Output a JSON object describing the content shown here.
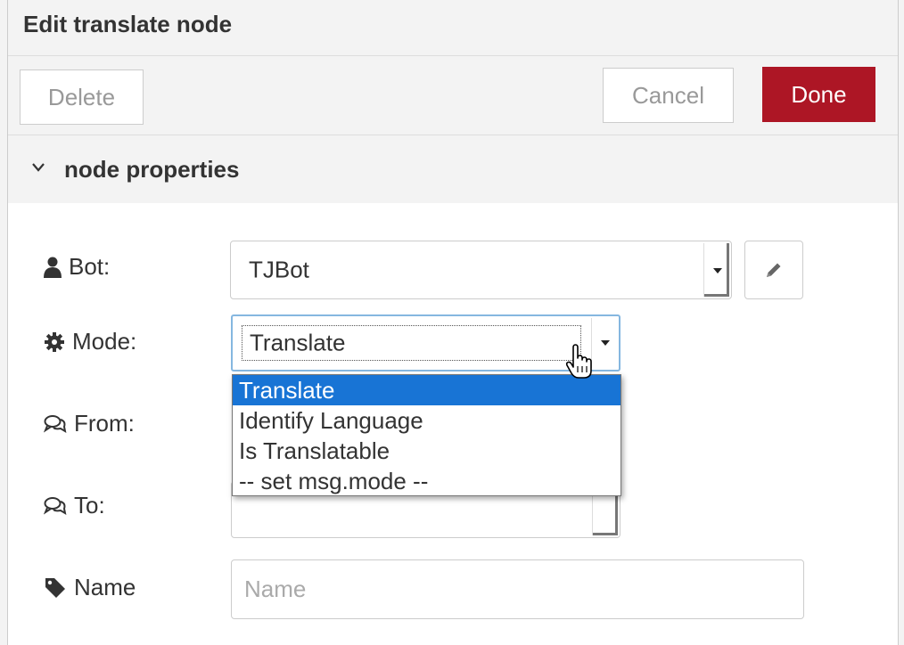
{
  "header": {
    "title": "Edit translate node"
  },
  "toolbar": {
    "delete_label": "Delete",
    "cancel_label": "Cancel",
    "done_label": "Done"
  },
  "section": {
    "title": "node properties"
  },
  "fields": {
    "bot": {
      "label": "Bot:",
      "value": "TJBot",
      "icon": "user-icon"
    },
    "mode": {
      "label": "Mode:",
      "value": "Translate",
      "icon": "gear-icon",
      "options": [
        "Translate",
        "Identify Language",
        "Is Translatable",
        "-- set msg.mode --"
      ],
      "selected_index": 0
    },
    "from": {
      "label": "From:",
      "icon": "comments-icon"
    },
    "to": {
      "label": "To:",
      "icon": "comments-icon"
    },
    "name": {
      "label": "Name",
      "placeholder": "Name",
      "value": "",
      "icon": "tag-icon"
    }
  },
  "colors": {
    "done": "#ad1625",
    "selected_option": "#1874d5",
    "focus_border": "#85b7e0"
  }
}
